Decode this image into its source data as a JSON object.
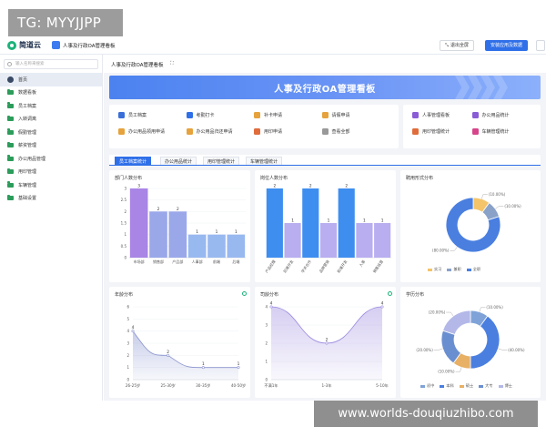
{
  "watermark_top": "TG: MYYJJPP",
  "watermark_bottom": "www.worlds-douqiuzhibo.com",
  "topbar": {
    "brand": "简道云",
    "app_title": "人事及行政OA管理看板",
    "exit_fullscreen": "退出全屏",
    "install_button": "安装应用及数据"
  },
  "sidebar": {
    "search_placeholder": "输入名称来搜索",
    "items": [
      {
        "label": "首页",
        "active": true
      },
      {
        "label": "数据看板"
      },
      {
        "label": "员工档案"
      },
      {
        "label": "入转调离"
      },
      {
        "label": "假勤管理"
      },
      {
        "label": "薪资管理"
      },
      {
        "label": "办公用品管理"
      },
      {
        "label": "用印管理"
      },
      {
        "label": "车辆管理"
      },
      {
        "label": "基础设置"
      }
    ]
  },
  "main": {
    "tab_title": "人事及行政OA管理看板",
    "fullscreen_icon": "⛶",
    "banner_title": "人事及行政OA管理看板"
  },
  "quick_links_left": [
    {
      "label": "员工档案",
      "color": "#3b6fd8"
    },
    {
      "label": "考勤打卡",
      "color": "#2f6fe8"
    },
    {
      "label": "补卡申请",
      "color": "#e6a23c"
    },
    {
      "label": "请假申请",
      "color": "#e6a23c"
    },
    {
      "label": "办公用品领用申请",
      "color": "#e6a23c"
    },
    {
      "label": "办公用品归还申请",
      "color": "#e6a23c"
    },
    {
      "label": "用印申请",
      "color": "#e06c3c"
    },
    {
      "label": "查看全部",
      "color": "#999999"
    }
  ],
  "quick_links_right": [
    {
      "label": "人事管理看板",
      "color": "#8a5cd6"
    },
    {
      "label": "办公用品统计",
      "color": "#8a5cd6"
    },
    {
      "label": "用印管理统计",
      "color": "#e06c3c"
    },
    {
      "label": "车辆管理统计",
      "color": "#d6458a"
    }
  ],
  "tabs": [
    "员工档案统计",
    "办公用品统计",
    "用印管理统计",
    "车辆管理统计"
  ],
  "chart_data": [
    {
      "type": "bar",
      "title": "部门人数分布",
      "categories": [
        "市场部",
        "销售部",
        "产品部",
        "人事部",
        "前端",
        "后端"
      ],
      "values": [
        3,
        2,
        2,
        1,
        1,
        1
      ],
      "ylim": [
        0,
        3
      ],
      "yticks": [
        "0",
        "0.5",
        "1",
        "1.5",
        "2",
        "2.5",
        "3"
      ],
      "colors": [
        "#a985e6",
        "#9aa8ea",
        "#9aa8ea",
        "#98b8f0",
        "#98b8f0",
        "#98b8f0"
      ]
    },
    {
      "type": "bar",
      "title": "岗位人数分布",
      "categories": [
        "产品经理",
        "后端开发",
        "学术合作",
        "品牌营销",
        "前端开发",
        "人事",
        "销售运营"
      ],
      "values": [
        2,
        1,
        2,
        1,
        2,
        1,
        1
      ],
      "ylim": [
        0,
        2
      ],
      "colors": [
        "#3e8ef0",
        "#b8aef0",
        "#3e8ef0",
        "#b8aef0",
        "#3e8ef0",
        "#b8aef0",
        "#b8aef0"
      ]
    },
    {
      "type": "pie",
      "title": "聘用形式分布",
      "series": [
        {
          "name": "实习",
          "value": 10,
          "label": "(10.00%)",
          "color": "#f3c46a"
        },
        {
          "name": "兼职",
          "value": 10,
          "label": "(10.00%)",
          "color": "#8aa2c8"
        },
        {
          "name": "全职",
          "value": 80,
          "label": "(80.00%)",
          "color": "#4a7fe0"
        }
      ]
    },
    {
      "type": "area",
      "title": "年龄分布",
      "categories": [
        "26-25岁",
        "25-30岁",
        "30-35岁",
        "40-50岁"
      ],
      "values": [
        4,
        2,
        1,
        1
      ],
      "ylim": [
        0,
        6
      ],
      "yticks": [
        "0",
        "1",
        "2",
        "3",
        "4",
        "5",
        "6"
      ]
    },
    {
      "type": "area",
      "title": "司龄分布",
      "categories": [
        "不满1年",
        "1-3年",
        "5-10年"
      ],
      "values": [
        4,
        2,
        4
      ],
      "ylim": [
        0,
        4
      ],
      "yticks": [
        "0",
        "1",
        "2",
        "3",
        "4"
      ]
    },
    {
      "type": "pie",
      "title": "学历分布",
      "series": [
        {
          "name": "初中",
          "value": 10,
          "label": "(10.00%)",
          "color": "#7fa3d8"
        },
        {
          "name": "本科",
          "value": 40,
          "label": "(40.00%)",
          "color": "#4a7fe0"
        },
        {
          "name": "硕士",
          "value": 10,
          "label": "(10.00%)",
          "color": "#e8b065"
        },
        {
          "name": "大专",
          "value": 20,
          "label": "(20.00%)",
          "color": "#6a8fd0"
        },
        {
          "name": "博士",
          "value": 20,
          "label": "(20.00%)",
          "color": "#b3b8e8"
        }
      ]
    }
  ]
}
